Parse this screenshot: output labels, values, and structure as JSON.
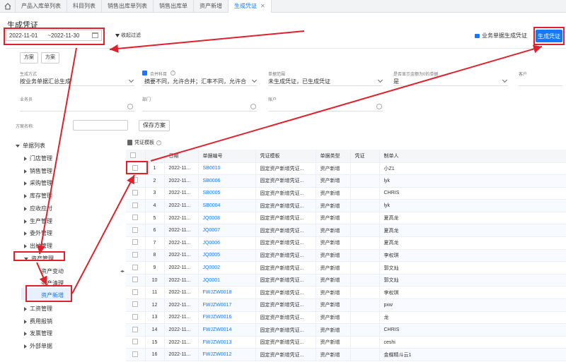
{
  "tabs": [
    {
      "label": "产品入库单列表"
    },
    {
      "label": "科目列表"
    },
    {
      "label": "销售出库单列表"
    },
    {
      "label": "销售出库单"
    },
    {
      "label": "资产新增"
    },
    {
      "label": "生成凭证",
      "active": true
    }
  ],
  "page_title": "生成凭证",
  "date_range": {
    "start": "2022-11-01",
    "sep": "~",
    "end": "2022-11-30"
  },
  "filter_label": "收起过滤",
  "single_gen_label": "业务单据生成凭证",
  "generate_button": "生成凭证",
  "schemes": [
    "方案",
    "方案"
  ],
  "filters": {
    "gen_mode_label": "生成方式",
    "gen_mode_value": "按业务单据汇总生成",
    "merge_label": "合并科目",
    "merge_value": "摘要不同，允许合并；汇率不同，允许合",
    "doc_range_label": "单据范围",
    "doc_range_value": "未生成凭证，已生成凭证",
    "zero_label": "是否显示金额为0的单据",
    "zero_value": "是",
    "customer_label": "客户",
    "salesman_label": "业务员",
    "dept_label": "部门",
    "account_label": "账户"
  },
  "scheme_name_label": "方案名称:",
  "save_scheme_button": "保存方案",
  "tree": {
    "root": "单据列表",
    "items": [
      "门店管理",
      "销售管理",
      "采购管理",
      "库存管理",
      "应收应付",
      "生产管理",
      "委外管理",
      "出纳管理",
      "资产管理",
      "资产变动",
      "资产清理",
      "资产新增",
      "工资管理",
      "费用报销",
      "发票管理",
      "外部单据"
    ]
  },
  "grid_title": "凭证模板",
  "table": {
    "headers": [
      "",
      "",
      "日期",
      "单据编号",
      "凭证模板",
      "单据类型",
      "凭证",
      "制单人"
    ],
    "rows": [
      [
        "1",
        "2022-11...",
        "SB0010",
        "固定资产新增凭证...",
        "资产新增",
        "",
        "小Z1"
      ],
      [
        "2",
        "2022-11...",
        "SB0006",
        "固定资产新增凭证...",
        "资产新增",
        "",
        "lyk"
      ],
      [
        "3",
        "2022-11...",
        "SB0005",
        "固定资产新增凭证...",
        "资产新增",
        "",
        "CHRIS"
      ],
      [
        "4",
        "2022-11...",
        "SB0004",
        "固定资产新增凭证...",
        "资产新增",
        "",
        "lyk"
      ],
      [
        "5",
        "2022-11...",
        "JQ0008",
        "固定资产新增凭证...",
        "资产新增",
        "",
        "夏高龙"
      ],
      [
        "6",
        "2022-11...",
        "JQ0007",
        "固定资产新增凭证...",
        "资产新增",
        "",
        "夏高龙"
      ],
      [
        "7",
        "2022-11...",
        "JQ0006",
        "固定资产新增凭证...",
        "资产新增",
        "",
        "夏高龙"
      ],
      [
        "8",
        "2022-11...",
        "JQ0005",
        "固定资产新增凭证...",
        "资产新增",
        "",
        "李权琪"
      ],
      [
        "9",
        "2022-11...",
        "JQ0002",
        "固定资产新增凭证...",
        "资产新增",
        "",
        "郭文灿"
      ],
      [
        "10",
        "2022-11...",
        "JQ0001",
        "固定资产新增凭证...",
        "资产新增",
        "",
        "郭文灿"
      ],
      [
        "11",
        "2022-11...",
        "FWJZW0018",
        "固定资产新增凭证...",
        "资产新增",
        "",
        "李权琪"
      ],
      [
        "12",
        "2022-11...",
        "FWJZW0017",
        "固定资产新增凭证...",
        "资产新增",
        "",
        "pxw"
      ],
      [
        "13",
        "2022-11...",
        "FWJZW0016",
        "固定资产新增凭证...",
        "资产新增",
        "",
        "龙"
      ],
      [
        "14",
        "2022-11...",
        "FWJZW0014",
        "固定资产新增凭证...",
        "资产新增",
        "",
        "CHRIS"
      ],
      [
        "15",
        "2022-11...",
        "FWJZW0013",
        "固定资产新增凭证...",
        "资产新增",
        "",
        "ceshi"
      ],
      [
        "16",
        "2022-11...",
        "FWJZW0012",
        "固定资产新增凭证...",
        "资产新增",
        "",
        "金蝶精斗云1"
      ]
    ]
  },
  "colors": {
    "accent": "#1677ff",
    "annotation": "#e0202a"
  }
}
